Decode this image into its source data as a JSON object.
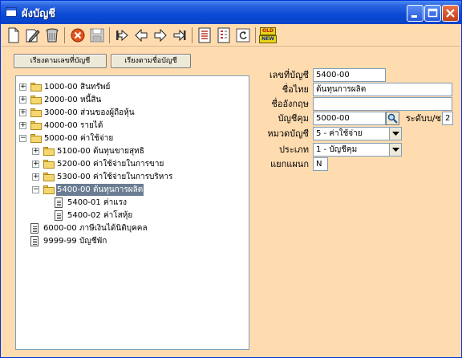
{
  "window": {
    "title": "ผังบัญชี"
  },
  "buttons": {
    "sort_by_number": "เรียงตามเลขที่บัญชี",
    "sort_by_name": "เรียงตามชื่อบัญชี"
  },
  "toolbar": {
    "badge_top": "OLD",
    "badge_bottom": "NEW"
  },
  "tree": {
    "nodes": [
      {
        "text": "1000-00 สินทรัพย์"
      },
      {
        "text": "2000-00 หนี้สิน"
      },
      {
        "text": "3000-00 ส่วนของผู้ถือหุ้น"
      },
      {
        "text": "4000-00 รายได้"
      },
      {
        "text": "5000-00 ค่าใช้จ่าย"
      },
      {
        "text": "5100-00 ต้นทุนขายสุทธิ"
      },
      {
        "text": "5200-00 ค่าใช้จ่ายในการขาย"
      },
      {
        "text": "5300-00 ค่าใช้จ่ายในการบริหาร"
      },
      {
        "text": "5400-00 ต้นทุนการผลิต"
      },
      {
        "text": "5400-01 ค่าแรง"
      },
      {
        "text": "5400-02 ค่าโสหุ้ย"
      },
      {
        "text": "6000-00 ภาษีเงินได้นิติบุคคล"
      },
      {
        "text": "9999-99 บัญชีพัก"
      }
    ]
  },
  "form": {
    "account_no": {
      "label": "เลขที่บัญชี",
      "value": "5400-00"
    },
    "thai_name": {
      "label": "ชื่อไทย",
      "value": "ต้นทุนการผลิต"
    },
    "english_name": {
      "label": "ชื่ออังกฤษ",
      "value": ""
    },
    "control_account": {
      "label": "บัญชีคุม",
      "value": "5000-00"
    },
    "level": {
      "label": "ระดับบ/ช",
      "value": "2"
    },
    "category": {
      "label": "หมวดบัญชี",
      "value": "5 - ค่าใช้จ่าย"
    },
    "type": {
      "label": "ประเภท",
      "value": "1 - บัญชีคุม"
    },
    "department_split": {
      "label": "แยกแผนก",
      "value": "N"
    }
  },
  "colors": {
    "window_bg": "#ffdcb0",
    "titlebar": "#0a4ad6",
    "selection": "#6b7d92"
  }
}
